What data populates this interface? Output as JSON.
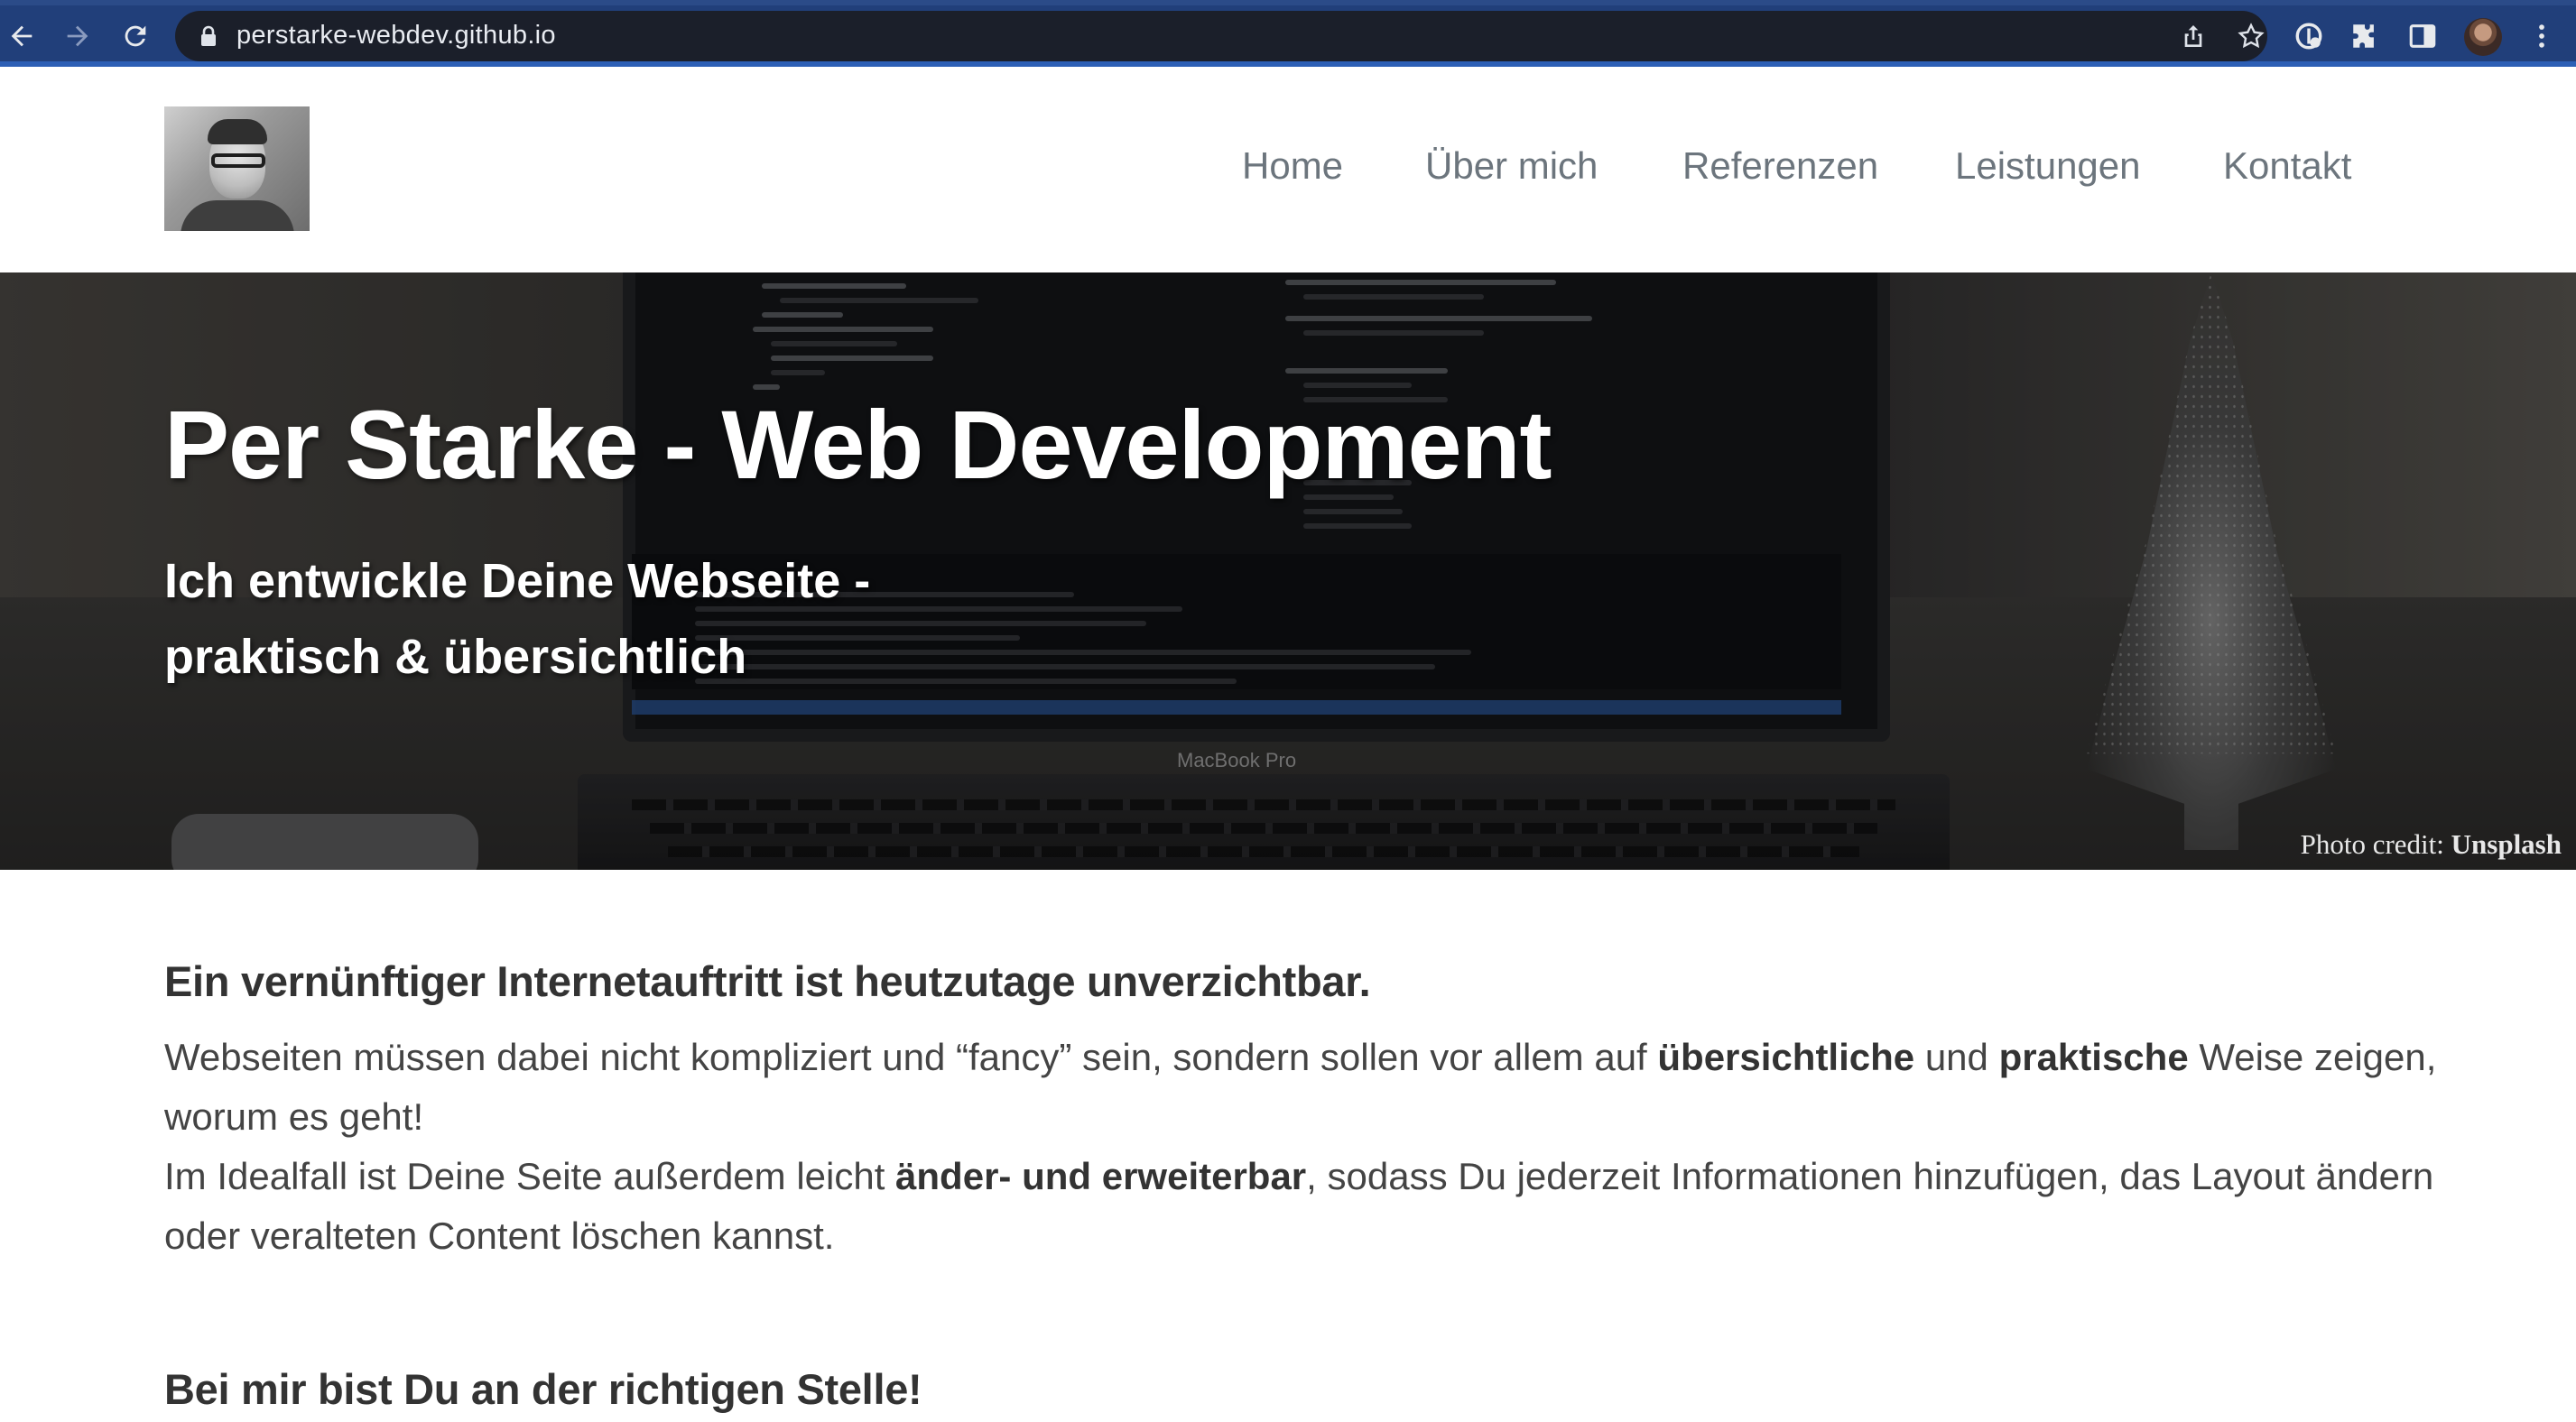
{
  "browser": {
    "url": "perstarke-webdev.github.io"
  },
  "site": {
    "nav": [
      "Home",
      "Über mich",
      "Referenzen",
      "Leistungen",
      "Kontakt"
    ]
  },
  "hero": {
    "title": "Per Starke - Web Development",
    "subtitle_line1": "Ich entwickle Deine Webseite -",
    "subtitle_line2": "praktisch & übersichtlich",
    "credit_prefix": "Photo credit:",
    "credit_source": "Unsplash",
    "laptop_label": "MacBook Pro"
  },
  "content": {
    "heading1": "Ein vernünftiger Internetauftritt ist heutzutage unverzichtbar.",
    "p1_part1": "Webseiten müssen dabei nicht kompliziert und “fancy” sein, sondern sollen vor allem auf ",
    "p1_bold1": "übersichtliche",
    "p1_part2": " und ",
    "p1_bold2": "praktische",
    "p1_part3": " Weise zeigen, worum es geht!",
    "p2_part1": "Im Idealfall ist Deine Seite außerdem leicht ",
    "p2_bold": "änder- und erweiterbar",
    "p2_part2": ", sodass Du jederzeit Informationen hinzufügen, das Layout ändern oder veralteten Content löschen kannst.",
    "heading2": "Bei mir bist Du an der richtigen Stelle!"
  },
  "colors": {
    "chrome": "#213f7a",
    "nav_text": "#6c757d",
    "heading_text": "#333333"
  }
}
